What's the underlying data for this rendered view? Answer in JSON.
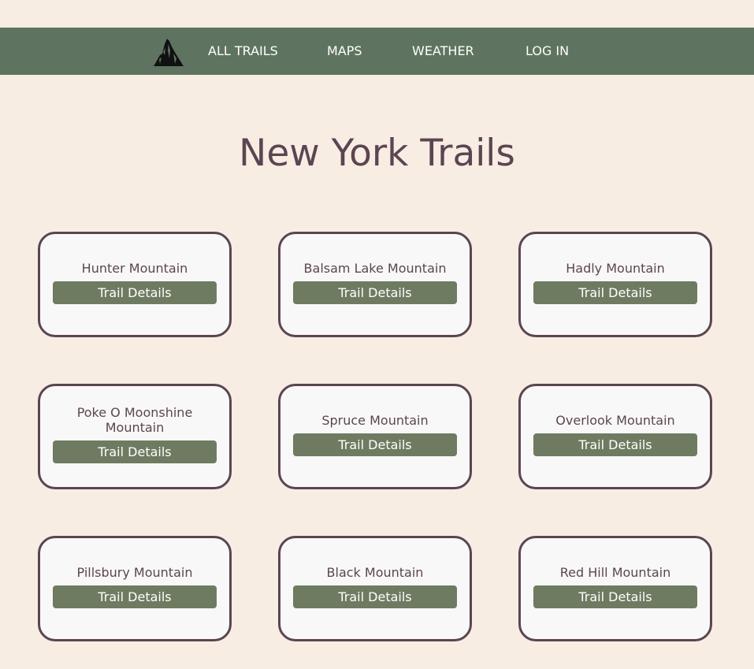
{
  "nav": {
    "logo_icon": "mountain-peak-icon",
    "links": [
      {
        "label": "ALL TRAILS"
      },
      {
        "label": "MAPS"
      },
      {
        "label": "WEATHER"
      },
      {
        "label": "LOG IN"
      }
    ]
  },
  "page": {
    "title": "New York Trails"
  },
  "trails": [
    {
      "name": "Hunter Mountain",
      "button_label": "Trail Details"
    },
    {
      "name": "Balsam Lake Mountain",
      "button_label": "Trail Details"
    },
    {
      "name": "Hadly Mountain",
      "button_label": "Trail Details"
    },
    {
      "name": "Poke O Moonshine Mountain",
      "button_label": "Trail Details"
    },
    {
      "name": "Spruce Mountain",
      "button_label": "Trail Details"
    },
    {
      "name": "Overlook Mountain",
      "button_label": "Trail Details"
    },
    {
      "name": "Pillsbury Mountain",
      "button_label": "Trail Details"
    },
    {
      "name": "Black Mountain",
      "button_label": "Trail Details"
    },
    {
      "name": "Red Hill Mountain",
      "button_label": "Trail Details"
    }
  ],
  "colors": {
    "background": "#f8ede2",
    "navbar": "#5f7460",
    "accent_text": "#5b4552",
    "button": "#6e7b61",
    "card": "#f9f8f8"
  }
}
